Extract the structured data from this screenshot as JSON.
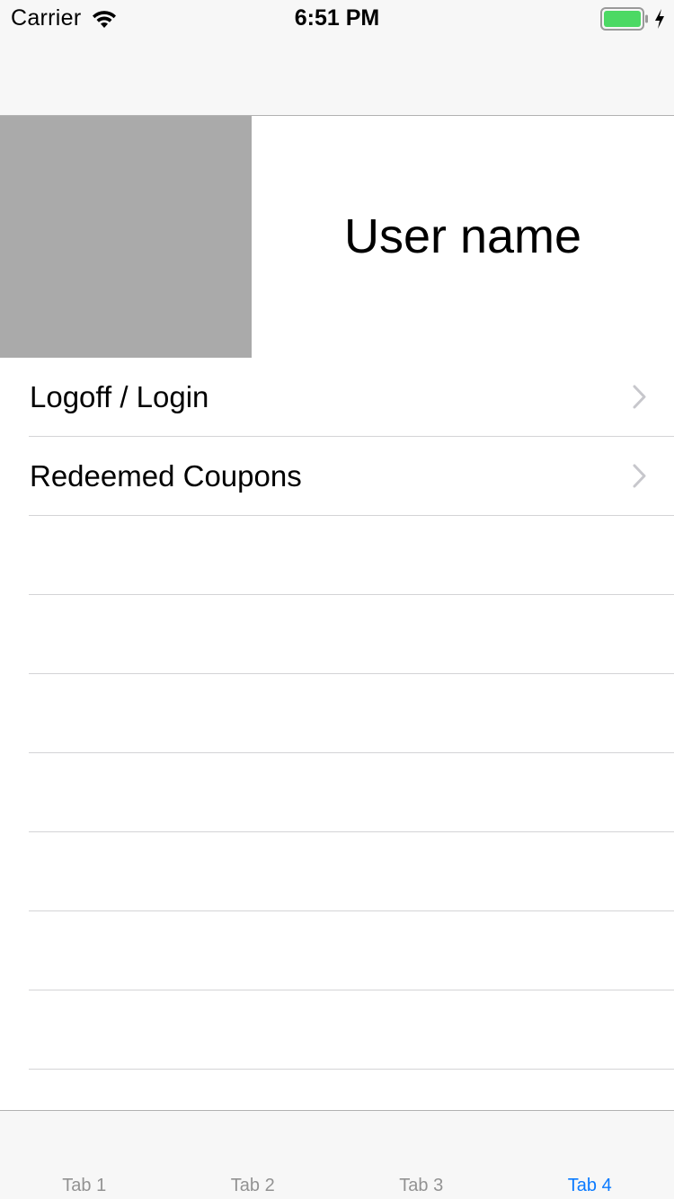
{
  "status_bar": {
    "carrier": "Carrier",
    "time": "6:51 PM",
    "icons": [
      "wifi-icon",
      "battery-icon",
      "charging-icon"
    ],
    "battery_color": "#4cd964"
  },
  "header": {
    "user_name": "User name",
    "avatar_color": "#aaaaaa"
  },
  "menu": {
    "items": [
      {
        "label": "Logoff / Login"
      },
      {
        "label": "Redeemed Coupons"
      },
      {
        "label": ""
      },
      {
        "label": ""
      },
      {
        "label": ""
      },
      {
        "label": ""
      },
      {
        "label": ""
      },
      {
        "label": ""
      },
      {
        "label": ""
      }
    ]
  },
  "tab_bar": {
    "tabs": [
      {
        "label": "Tab 1",
        "active": false
      },
      {
        "label": "Tab 2",
        "active": false
      },
      {
        "label": "Tab 3",
        "active": false
      },
      {
        "label": "Tab 4",
        "active": true
      }
    ],
    "active_color": "#0a7aff",
    "inactive_color": "#929292"
  }
}
